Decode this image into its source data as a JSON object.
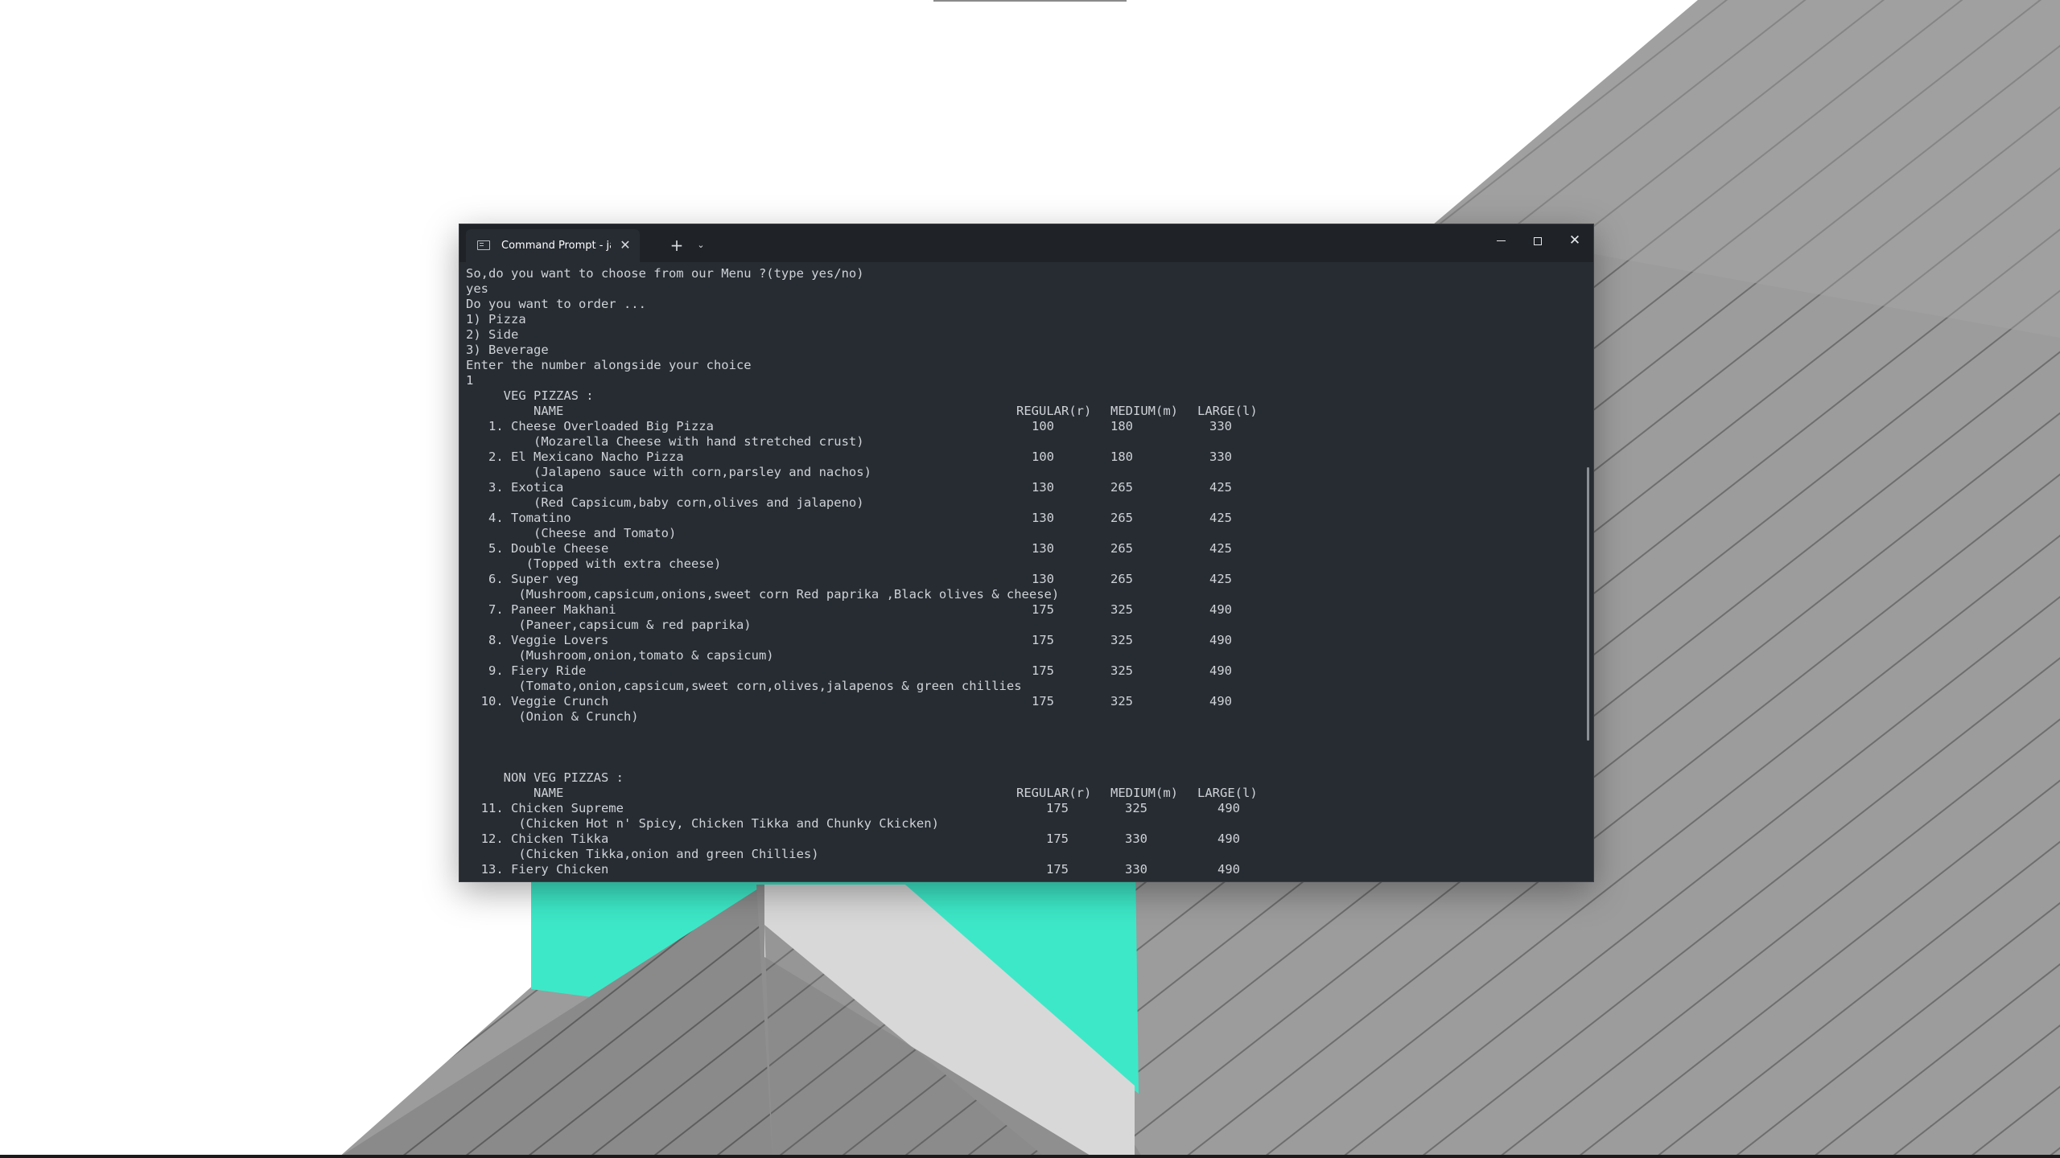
{
  "window": {
    "tab_title": "Command Prompt - java  Pizza",
    "tab_close_icon": "close-icon",
    "new_tab_label": "+",
    "dropdown_label": "⌄",
    "minimize_icon": "minimize-icon",
    "maximize_icon": "maximize-icon",
    "close_label": "✕"
  },
  "colors": {
    "terminal_bg": "#272c33",
    "titlebar_bg": "#1f2227",
    "terminal_text": "#cfd3d8",
    "wallpaper_accent": "#3de8c8"
  },
  "console": {
    "lines": [
      "So,do you want to choose from our Menu ?(type yes/no)",
      "yes",
      "Do you want to order ...",
      "1) Pizza",
      "2) Side",
      "3) Beverage",
      "Enter the number alongside your choice",
      "1",
      "     VEG PIZZAS :",
      "         NAME",
      "   1. Cheese Overloaded Big Pizza",
      "         (Mozarella Cheese with hand stretched crust)",
      "   2. El Mexicano Nacho Pizza",
      "         (Jalapeno sauce with corn,parsley and nachos)",
      "   3. Exotica",
      "         (Red Capsicum,baby corn,olives and jalapeno)",
      "   4. Tomatino",
      "         (Cheese and Tomato)",
      "   5. Double Cheese",
      "        (Topped with extra cheese)",
      "   6. Super veg",
      "       (Mushroom,capsicum,onions,sweet corn Red paprika ,Black olives & cheese)",
      "   7. Paneer Makhani",
      "       (Paneer,capsicum & red paprika)",
      "   8. Veggie Lovers",
      "       (Mushroom,onion,tomato & capsicum)",
      "   9. Fiery Ride",
      "       (Tomato,onion,capsicum,sweet corn,olives,jalapenos & green chillies",
      "  10. Veggie Crunch",
      "       (Onion & Crunch)",
      "",
      "",
      "",
      "     NON VEG PIZZAS :",
      "         NAME",
      "  11. Chicken Supreme",
      "       (Chicken Hot n' Spicy, Chicken Tikka and Chunky Ckicken)",
      "  12. Chicken Tikka",
      "       (Chicken Tikka,onion and green Chillies)",
      "  13. Fiery Chicken"
    ],
    "veg_price_header": [
      "REGULAR(r)",
      "MEDIUM(m)",
      "LARGE(l)"
    ],
    "veg_prices": [
      [
        "100",
        "180",
        "330"
      ],
      [
        "100",
        "180",
        "330"
      ],
      [
        "130",
        "265",
        "425"
      ],
      [
        "130",
        "265",
        "425"
      ],
      [
        "130",
        "265",
        "425"
      ],
      [
        "130",
        "265",
        "425"
      ],
      [
        "175",
        "325",
        "490"
      ],
      [
        "175",
        "325",
        "490"
      ],
      [
        "175",
        "325",
        "490"
      ],
      [
        "175",
        "325",
        "490"
      ]
    ],
    "nonveg_price_header": [
      "REGULAR(r)",
      "MEDIUM(m)",
      "LARGE(l)"
    ],
    "nonveg_prices": [
      [
        "175",
        "325",
        "490"
      ],
      [
        "175",
        "330",
        "490"
      ],
      [
        "175",
        "330",
        "490"
      ]
    ]
  }
}
